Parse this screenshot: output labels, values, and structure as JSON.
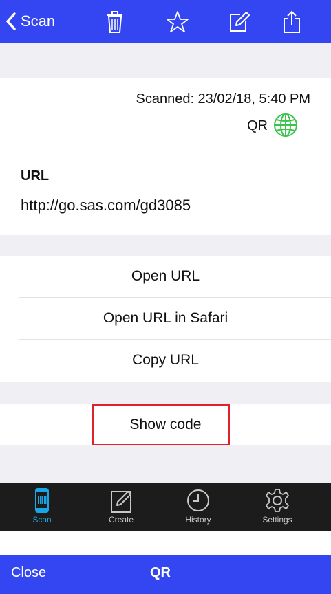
{
  "nav": {
    "back_label": "Scan",
    "icons": [
      "trash-icon",
      "star-icon",
      "edit-icon",
      "share-icon"
    ],
    "color": "#3446f2"
  },
  "meta": {
    "scanned": "Scanned: 23/02/18, 5:40 PM",
    "type": "QR",
    "type_icon": "globe-icon",
    "type_icon_color": "#3cc24d"
  },
  "field": {
    "label": "URL",
    "value": "http://go.sas.com/gd3085"
  },
  "actions": [
    {
      "label": "Open URL"
    },
    {
      "label": "Open URL in Safari"
    },
    {
      "label": "Copy URL"
    }
  ],
  "show_code": {
    "label": "Show code",
    "highlight_color": "#e0202a"
  },
  "tabs": [
    {
      "label": "Scan",
      "icon": "scan-phone-icon",
      "active": true
    },
    {
      "label": "Create",
      "icon": "create-icon",
      "active": false
    },
    {
      "label": "History",
      "icon": "clock-icon",
      "active": false
    },
    {
      "label": "Settings",
      "icon": "gear-icon",
      "active": false
    }
  ],
  "sheet": {
    "close_label": "Close",
    "title": "QR"
  }
}
